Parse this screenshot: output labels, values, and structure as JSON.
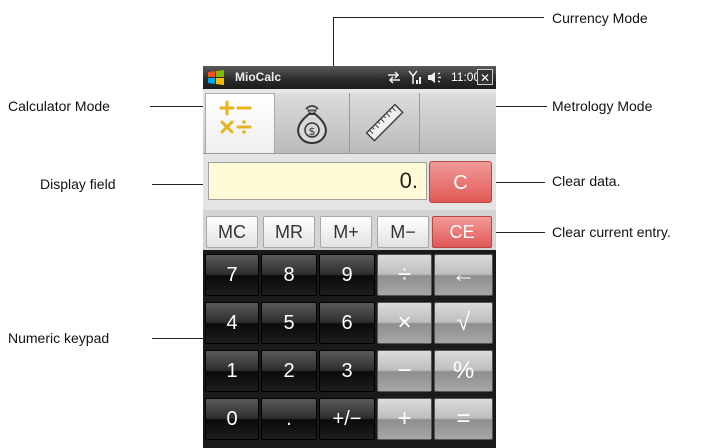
{
  "annotations": {
    "currency_mode": "Currency Mode",
    "calculator_mode": "Calculator Mode",
    "metrology_mode": "Metrology Mode",
    "display_field": "Display field",
    "clear_data": "Clear data.",
    "clear_entry": "Clear current entry.",
    "numeric_keypad": "Numeric keypad"
  },
  "titlebar": {
    "app_name": "MioCalc",
    "time": "11:00",
    "close_label": "✕",
    "icons": [
      "windows-logo-icon",
      "connectivity-icon",
      "signal-icon",
      "volume-icon"
    ]
  },
  "tabs": [
    {
      "id": "calculator",
      "icon": "calculator-icon",
      "selected": true
    },
    {
      "id": "currency",
      "icon": "money-bag-icon",
      "selected": false
    },
    {
      "id": "metrology",
      "icon": "ruler-icon",
      "selected": false
    }
  ],
  "display": {
    "value": "0."
  },
  "buttons": {
    "clear": "C",
    "clear_entry": "CE",
    "memory": [
      "MC",
      "MR",
      "M+",
      "M−"
    ]
  },
  "keypad": {
    "rows": [
      [
        "7",
        "8",
        "9",
        "÷",
        "←"
      ],
      [
        "4",
        "5",
        "6",
        "×",
        "√"
      ],
      [
        "1",
        "2",
        "3",
        "−",
        "%"
      ],
      [
        "0",
        ".",
        "+/−",
        "+",
        "="
      ]
    ]
  },
  "colors": {
    "display_bg": "#fffbd9",
    "clear_red": "#e05a57",
    "keypad_dark": "#1a1a1a"
  }
}
